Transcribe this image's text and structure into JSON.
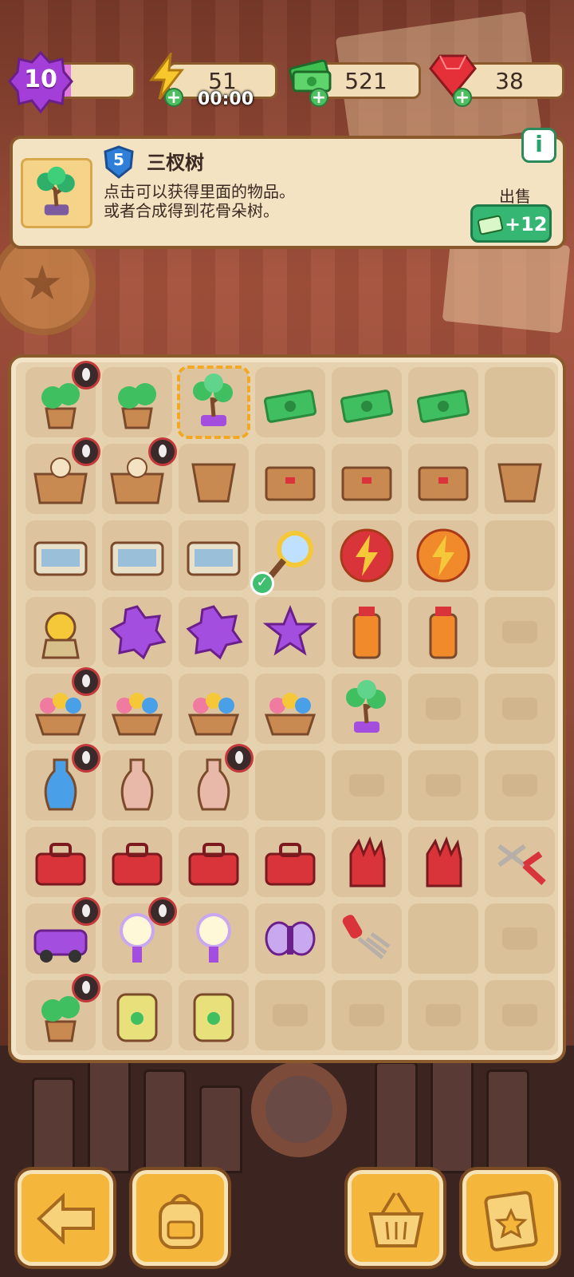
{
  "player": {
    "level": "10",
    "level_progress": 0.25
  },
  "resources": {
    "energy": {
      "value": "51",
      "timer": "00:00",
      "icon": "lightning-icon"
    },
    "cash": {
      "value": "521",
      "icon": "cash-stack-icon"
    },
    "gems": {
      "value": "38",
      "icon": "ruby-gem-icon"
    }
  },
  "info_panel": {
    "item_level": "5",
    "item_name": "三杈树",
    "desc_line1": "点击可以获得里面的物品。",
    "desc_line2": "或者合成得到花骨朵树。",
    "sell_label": "出售",
    "sell_value": "+12",
    "info_button": "i"
  },
  "board": {
    "rows": [
      [
        "potted-sprout",
        "leafy-bush",
        "bonsai-tree",
        "cash-pile",
        "cash-bundle",
        "cash-bill",
        "empty"
      ],
      [
        "open-box-vase",
        "open-box-items",
        "clay-pot",
        "cardboard-stack-3",
        "cardboard-stack-2",
        "cardboard-box",
        "broken-pot"
      ],
      [
        "sand-tray",
        "dig-site",
        "dig-site-magnifier",
        "magnifying-glass",
        "energy-orb-red",
        "energy-orb-orange",
        "empty"
      ],
      [
        "sprout-doll",
        "purple-blob-big",
        "purple-blob",
        "purple-star",
        "juice-bottle",
        "juice-box",
        "empty-ghost"
      ],
      [
        "flower-basket-big",
        "flower-crate-red",
        "flower-crate-mixed",
        "flower-crate-yellow",
        "bonsai-small",
        "empty-ghost",
        "empty-ghost"
      ],
      [
        "vase-ornate",
        "vase-tall",
        "vase-striped",
        "empty",
        "empty-ghost",
        "empty-ghost",
        "empty-ghost"
      ],
      [
        "toolbox-open-big",
        "toolbox-open",
        "toolbox-closed",
        "toolbox-small",
        "red-gloves",
        "red-glove",
        "pruning-shears"
      ],
      [
        "purple-car",
        "lamp-cluster",
        "lamp-single",
        "moth",
        "garden-fork",
        "empty",
        "empty-ghost"
      ],
      [
        "potted-plant-seeds",
        "seed-sack",
        "seed-packet",
        "empty-ghost",
        "empty-ghost",
        "empty-ghost",
        "empty-ghost"
      ]
    ],
    "selected": "bonsai-tree",
    "locked": [
      "potted-sprout",
      "open-box-vase",
      "open-box-items",
      "flower-basket-big",
      "vase-ornate",
      "vase-striped",
      "purple-car",
      "lamp-cluster",
      "potted-plant-seeds"
    ]
  },
  "bottom_bar": {
    "buttons": [
      "back-arrow-icon",
      "backpack-icon",
      "basket-icon",
      "clipboard-star-icon"
    ]
  },
  "colors": {
    "accent": "#f5b63c",
    "panel": "#f3e3c3",
    "border": "#8a5a2c",
    "sell": "#35b672",
    "level": "#a43ed8"
  }
}
